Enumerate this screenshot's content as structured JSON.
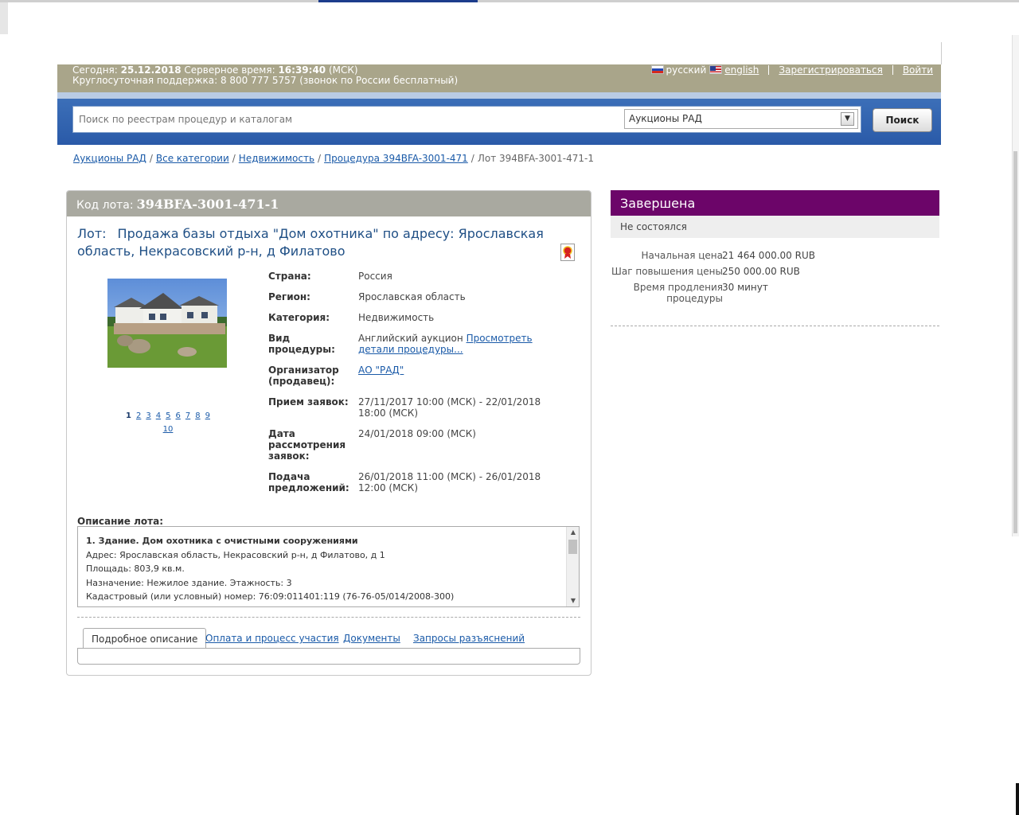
{
  "header": {
    "today_label": "Сегодня:",
    "today_date": "25.12.2018",
    "server_time_label": "Серверное время:",
    "server_time": "16:39:40",
    "timezone": "(МСК)",
    "support_text": "Круглосуточная поддержка: 8 800 777 5757 (звонок по России бесплатный)",
    "lang_ru": "русский",
    "lang_en": "english",
    "register": "Зарегистрироваться",
    "login": "Войти"
  },
  "search": {
    "placeholder": "Поиск по реестрам процедур и каталогам",
    "select_value": "Аукционы РАД",
    "button": "Поиск"
  },
  "breadcrumb": {
    "items": [
      "Аукционы РАД",
      "Все категории",
      "Недвижимость",
      "Процедура 394BFA-3001-471"
    ],
    "current": "Лот 394BFA-3001-471-1"
  },
  "lot": {
    "code_label": "Код лота:",
    "code": "394BFA-3001-471-1",
    "title_prefix": "Лот:",
    "title": "Продажа базы отдыха \"Дом охотника\" по адресу: Ярославская область, Некрасовский р-н, д Филатово",
    "pager": {
      "current": "1",
      "pages": [
        "2",
        "3",
        "4",
        "5",
        "6",
        "7",
        "8",
        "9",
        "10"
      ]
    },
    "props": {
      "country_label": "Страна:",
      "country": "Россия",
      "region_label": "Регион:",
      "region": "Ярославская область",
      "category_label": "Категория:",
      "category": "Недвижимость",
      "procedure_label": "Вид процедуры:",
      "procedure": "Английский аукцион",
      "procedure_link": "Просмотреть детали процедуры...",
      "organizer_label": "Организатор (продавец):",
      "organizer": "АО \"РАД\"",
      "applications_label": "Прием заявок:",
      "applications": "27/11/2017 10:00 (МСК) - 22/01/2018 18:00 (МСК)",
      "review_label": "Дата рассмотрения заявок:",
      "review": "24/01/2018 09:00 (МСК)",
      "bids_label": "Подача предложений:",
      "bids": "26/01/2018 11:00 (МСК) - 26/01/2018 12:00 (МСК)"
    },
    "description_label": "Описание лота:",
    "description_lines": [
      "1. Здание. Дом охотника с очистными сооружениями",
      "Адрес: Ярославская область, Некрасовский р-н, д Филатово, д 1",
      "Площадь: 803,9 кв.м.",
      "Назначение: Нежилое здание. Этажность: 3",
      "Кадастровый (или условный) номер: 76:09:011401:119 (76-76-05/014/2008-300)"
    ],
    "tabs": [
      "Подробное описание",
      "Оплата и процесс участия",
      "Документы",
      "Запросы разъяснений"
    ]
  },
  "status": {
    "title": "Завершена",
    "subtitle": "Не состоялся",
    "start_price_label": "Начальная цена",
    "start_price": "21 464 000.00 RUB",
    "step_label": "Шаг повышения цены",
    "step": "250 000.00 RUB",
    "extension_label": "Время продления процедуры",
    "extension": "30 минут"
  },
  "colors": {
    "info_bar": "#a9a58a",
    "blue_bar": "#2a5aa8",
    "status_bar": "#6c0569",
    "link": "#1a5aa8"
  }
}
